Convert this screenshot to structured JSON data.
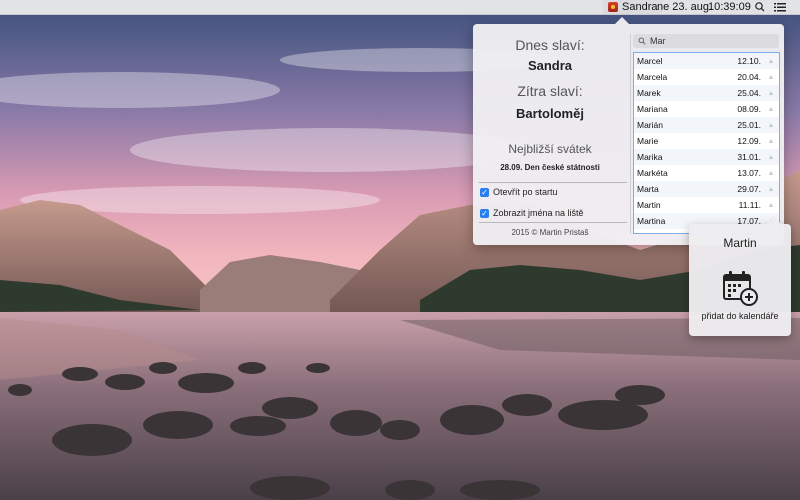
{
  "menubar": {
    "app_name": "Sandra",
    "date": "ne 23. aug.",
    "time": "10:39:09",
    "app_icon": "calendar-app-icon",
    "spotlight_icon": "search-icon",
    "notifications_icon": "list-icon"
  },
  "popover": {
    "today_label": "Dnes slaví:",
    "today_name": "Sandra",
    "tomorrow_label": "Zítra slaví:",
    "tomorrow_name": "Bartoloměj",
    "holiday_label": "Nejbližší svátek",
    "holiday_date": "28.09. Den české státnosti",
    "options": [
      {
        "label": "Otevřít po startu",
        "checked": true
      },
      {
        "label": "Zobrazit jména na liště",
        "checked": true
      }
    ],
    "copyright": "2015 © Martin Pristaš",
    "search": {
      "value": "Mar",
      "icon": "search-icon"
    },
    "names": [
      {
        "name": "Marcel",
        "date": "12.10."
      },
      {
        "name": "Marcela",
        "date": "20.04."
      },
      {
        "name": "Marek",
        "date": "25.04."
      },
      {
        "name": "Mariana",
        "date": "08.09."
      },
      {
        "name": "Marián",
        "date": "25.01."
      },
      {
        "name": "Marie",
        "date": "12.09."
      },
      {
        "name": "Marika",
        "date": "31.01."
      },
      {
        "name": "Markéta",
        "date": "13.07."
      },
      {
        "name": "Marta",
        "date": "29.07."
      },
      {
        "name": "Martin",
        "date": "11.11."
      },
      {
        "name": "Martina",
        "date": "17.07."
      }
    ]
  },
  "detail": {
    "name": "Martin",
    "icon": "calendar-add-icon",
    "action_label": "přidat do kalendáře"
  },
  "colors": {
    "accent": "#2a7ff0",
    "list_border": "#7eaee8"
  }
}
